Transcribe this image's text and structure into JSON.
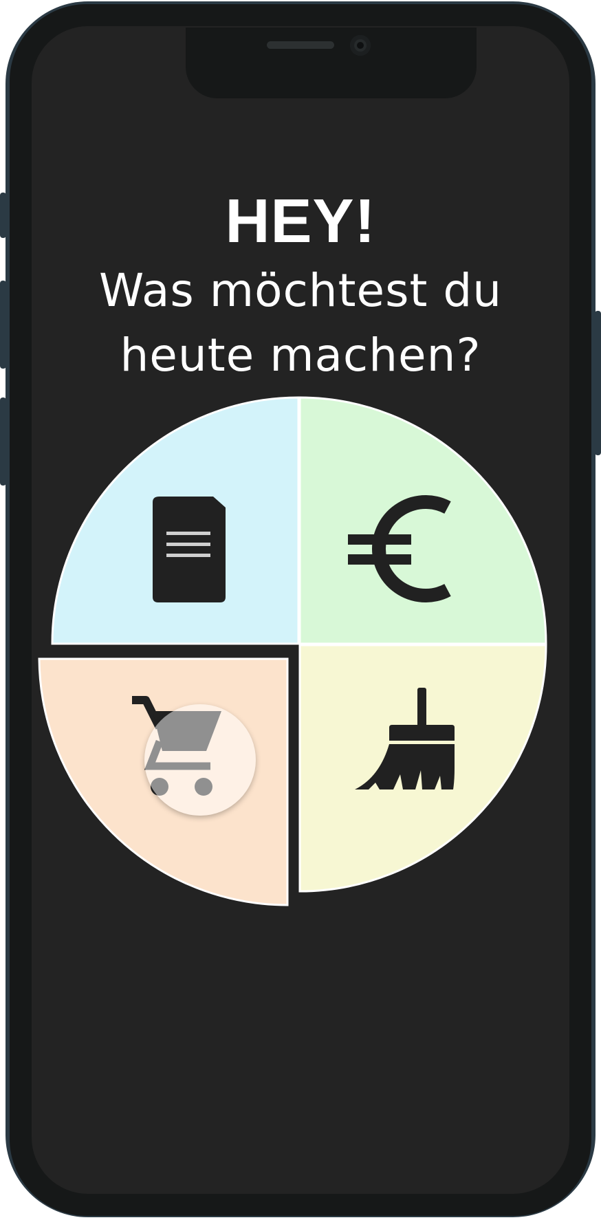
{
  "screen": {
    "greeting_title": "HEY!",
    "greeting_subtitle_line1": "Was möchtest du",
    "greeting_subtitle_line2": "heute machen?"
  },
  "menu_wheel": {
    "segments": [
      {
        "id": "documents",
        "icon": "document-icon",
        "color": "#d3f3fa"
      },
      {
        "id": "finances",
        "icon": "euro-icon",
        "color": "#d8f8d7"
      },
      {
        "id": "shopping",
        "icon": "shopping-cart-icon",
        "color": "#fce3cc",
        "state": "pressed"
      },
      {
        "id": "cleaning",
        "icon": "broom-icon",
        "color": "#f7f7d3"
      }
    ]
  },
  "colors": {
    "screen_background": "#232323",
    "text": "#ffffff",
    "icon": "#212121"
  }
}
